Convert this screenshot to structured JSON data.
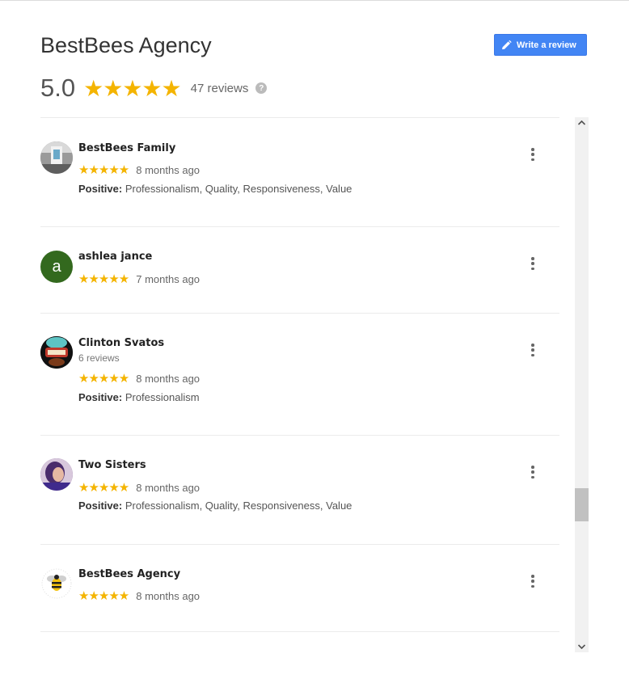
{
  "header": {
    "title": "BestBees Agency",
    "write_review_label": "Write a review",
    "rating": "5.0",
    "stars": "★★★★★",
    "review_count": "47 reviews",
    "help_glyph": "?"
  },
  "reviews": [
    {
      "name": "BestBees Family",
      "avatar": "photo",
      "stars": "★★★★★",
      "rating": 5,
      "time": "8 months ago",
      "attributes_label": "Positive:",
      "attributes": "Professionalism, Quality, Responsiveness, Value"
    },
    {
      "name": "ashlea jance",
      "avatar_letter": "a",
      "avatar_color": "#33691e",
      "stars": "★★★★★",
      "rating": 5,
      "time": "7 months ago"
    },
    {
      "name": "Clinton Svatos",
      "sub": "6 reviews",
      "avatar": "photo",
      "stars": "★★★★★",
      "rating": 5,
      "time": "8 months ago",
      "attributes_label": "Positive:",
      "attributes": "Professionalism"
    },
    {
      "name": "Two Sisters",
      "avatar": "photo",
      "stars": "★★★★★",
      "rating": 5,
      "time": "8 months ago",
      "attributes_label": "Positive:",
      "attributes": "Professionalism, Quality, Responsiveness, Value"
    },
    {
      "name": "BestBees Agency",
      "avatar": "logo",
      "stars": "★★★★★",
      "rating": 5,
      "time": "8 months ago"
    }
  ],
  "colors": {
    "accent": "#4285f4",
    "star": "#f4b400"
  }
}
